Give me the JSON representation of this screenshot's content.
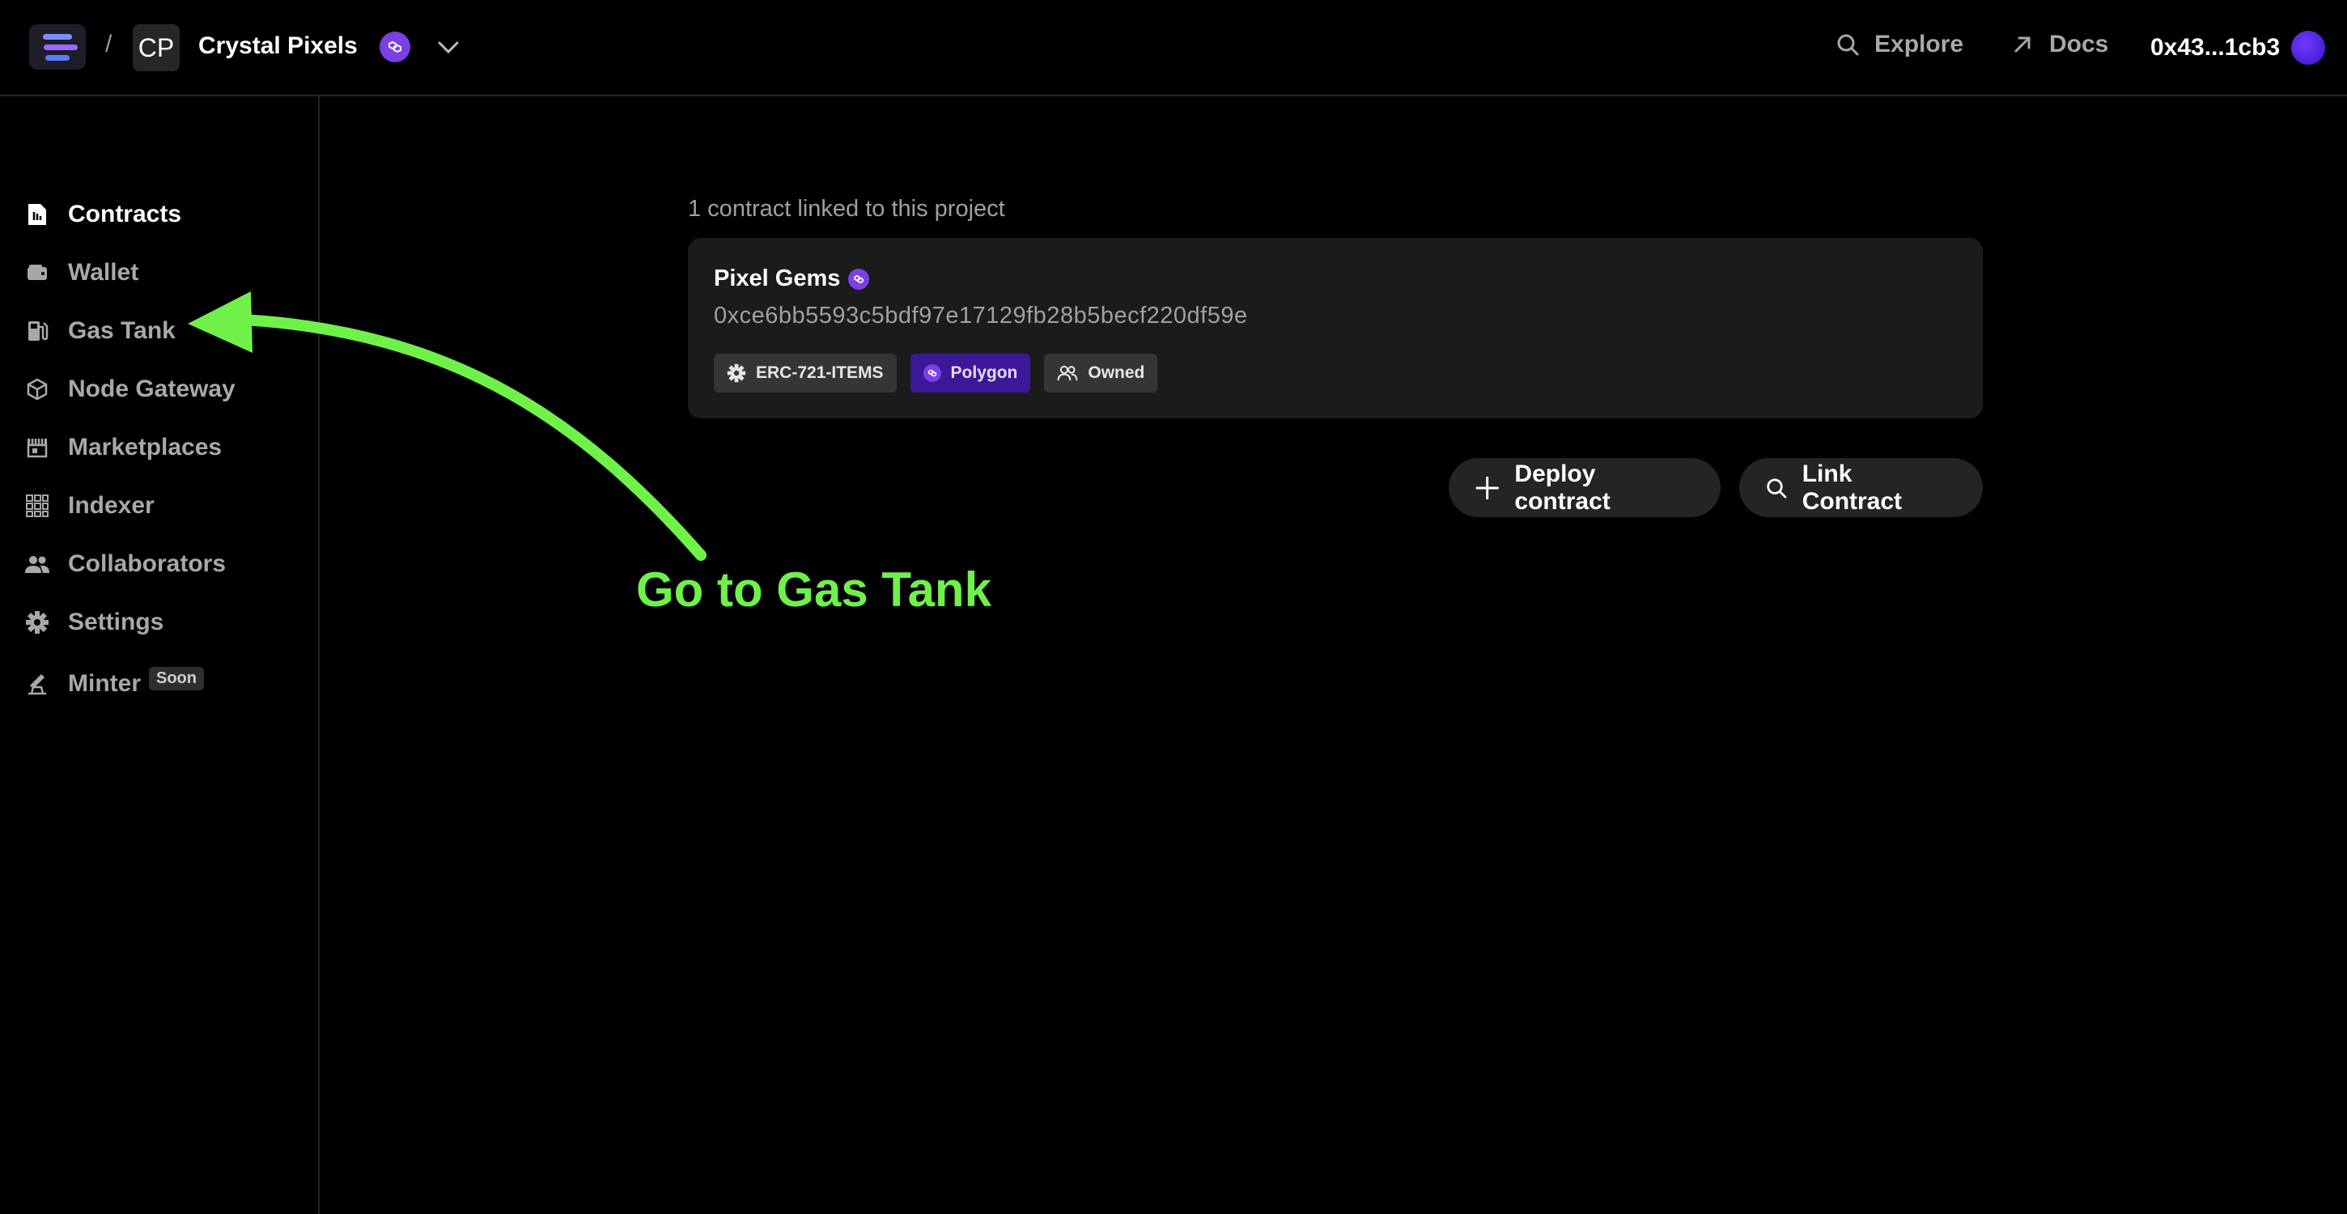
{
  "header": {
    "breadcrumb_separator": "/",
    "project_initials": "CP",
    "project_name": "Crystal Pixels",
    "nav_explore": "Explore",
    "nav_docs": "Docs",
    "wallet_address": "0x43...1cb3"
  },
  "sidebar": {
    "items": [
      {
        "label": "Contracts",
        "icon": "contract-icon",
        "active": true
      },
      {
        "label": "Wallet",
        "icon": "wallet-icon"
      },
      {
        "label": "Gas Tank",
        "icon": "gas-pump-icon"
      },
      {
        "label": "Node Gateway",
        "icon": "cube-icon"
      },
      {
        "label": "Marketplaces",
        "icon": "storefront-icon"
      },
      {
        "label": "Indexer",
        "icon": "grid-icon"
      },
      {
        "label": "Collaborators",
        "icon": "users-icon"
      },
      {
        "label": "Settings",
        "icon": "gear-icon"
      },
      {
        "label": "Minter",
        "icon": "minter-icon",
        "badge": "Soon"
      }
    ]
  },
  "main": {
    "linked_text": "1 contract linked to this project",
    "contract": {
      "name": "Pixel Gems",
      "address": "0xce6bb5593c5bdf97e17129fb28b5becf220df59e",
      "tags": [
        "ERC-721-ITEMS",
        "Polygon",
        "Owned"
      ]
    },
    "deploy_button": "Deploy contract",
    "link_button": "Link Contract"
  },
  "annotation": {
    "text": "Go to Gas Tank",
    "color": "#6ff14a"
  },
  "colors": {
    "background": "#000000",
    "accent_purple": "#7b3fe4",
    "card_bg": "#1b1b1b",
    "muted_text": "#a8a8a8"
  }
}
